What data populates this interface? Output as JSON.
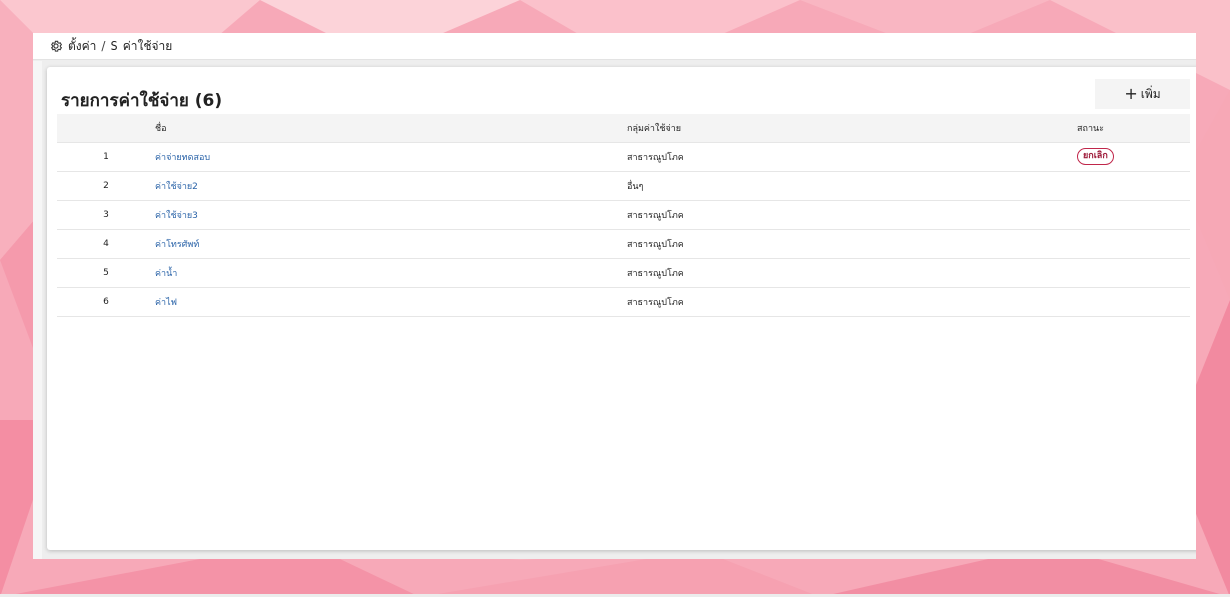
{
  "breadcrumb": {
    "section": "ตั้งค่า",
    "separator": "/",
    "page_icon": "S",
    "page": "ค่าใช้จ่าย"
  },
  "list": {
    "title": "รายการค่าใช้จ่าย (6)",
    "add_label": "เพิ่ม",
    "columns": {
      "index": "",
      "name": "ชื่อ",
      "group": "กลุ่มค่าใช้จ่าย",
      "status": "สถานะ"
    },
    "rows": [
      {
        "index": "1",
        "name": "ค่าจ่ายทดสอบ",
        "group": "สาธารณูปโภค",
        "status": "ยกเลิก"
      },
      {
        "index": "2",
        "name": "ค่าใช้จ่าย2",
        "group": "อื่นๆ",
        "status": ""
      },
      {
        "index": "3",
        "name": "ค่าใช้จ่าย3",
        "group": "สาธารณูปโภค",
        "status": ""
      },
      {
        "index": "4",
        "name": "ค่าโทรศัพท์",
        "group": "สาธารณูปโภค",
        "status": ""
      },
      {
        "index": "5",
        "name": "ค่าน้ำ",
        "group": "สาธารณูปโภค",
        "status": ""
      },
      {
        "index": "6",
        "name": "ค่าไฟ",
        "group": "สาธารณูปโภค",
        "status": ""
      }
    ]
  },
  "colors": {
    "link": "#2a63a8",
    "badge_cancel": "#9e1b3a",
    "background": "#f7a9b8"
  },
  "icons": {
    "settings": "gear-icon",
    "add": "plus-icon"
  }
}
